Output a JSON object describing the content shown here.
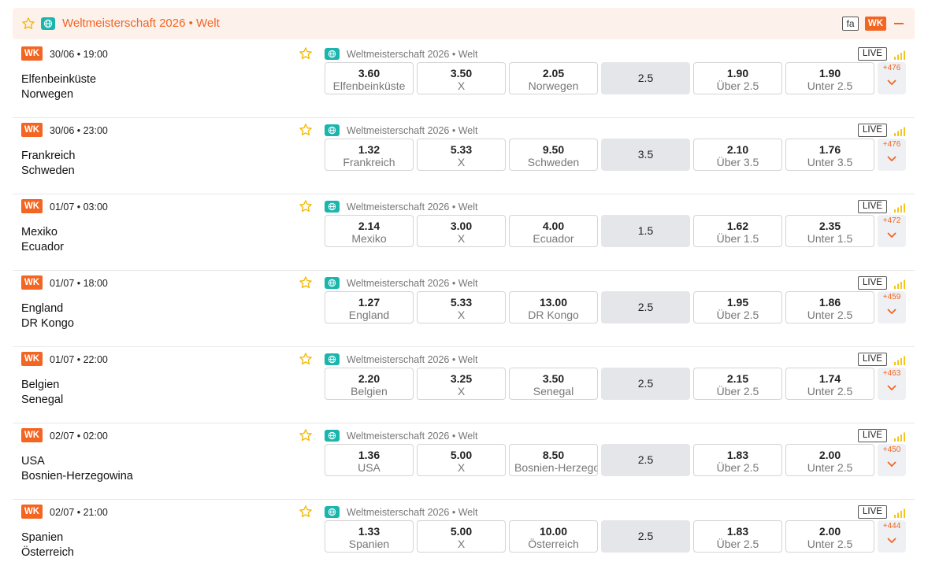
{
  "league": {
    "title": "Weltmeisterschaft 2026 • Welt",
    "badge": "WK",
    "fa_label": "fa",
    "accent": "#f26522",
    "globe_color": "#1ab5ad",
    "favorite_icon": "star-outline-icon",
    "collapse_icon": "minus-icon"
  },
  "matches": [
    {
      "badge": "WK",
      "time": "30/06 • 19:00",
      "team1": "Elfenbeinküste",
      "team2": "Norwegen",
      "league": "Weltmeisterschaft 2026 • Welt",
      "live": "LIVE",
      "odds": [
        {
          "value": "3.60",
          "label": "Elfenbeinküste"
        },
        {
          "value": "3.50",
          "label": "X"
        },
        {
          "value": "2.05",
          "label": "Norwegen"
        }
      ],
      "line": "2.5",
      "ou": [
        {
          "value": "1.90",
          "label": "Über 2.5"
        },
        {
          "value": "1.90",
          "label": "Unter 2.5"
        }
      ],
      "more": "+476"
    },
    {
      "badge": "WK",
      "time": "30/06 • 23:00",
      "team1": "Frankreich",
      "team2": "Schweden",
      "league": "Weltmeisterschaft 2026 • Welt",
      "live": "LIVE",
      "odds": [
        {
          "value": "1.32",
          "label": "Frankreich"
        },
        {
          "value": "5.33",
          "label": "X"
        },
        {
          "value": "9.50",
          "label": "Schweden"
        }
      ],
      "line": "3.5",
      "ou": [
        {
          "value": "2.10",
          "label": "Über 3.5"
        },
        {
          "value": "1.76",
          "label": "Unter 3.5"
        }
      ],
      "more": "+476"
    },
    {
      "badge": "WK",
      "time": "01/07 • 03:00",
      "team1": "Mexiko",
      "team2": "Ecuador",
      "league": "Weltmeisterschaft 2026 • Welt",
      "live": "LIVE",
      "odds": [
        {
          "value": "2.14",
          "label": "Mexiko"
        },
        {
          "value": "3.00",
          "label": "X"
        },
        {
          "value": "4.00",
          "label": "Ecuador"
        }
      ],
      "line": "1.5",
      "ou": [
        {
          "value": "1.62",
          "label": "Über 1.5"
        },
        {
          "value": "2.35",
          "label": "Unter 1.5"
        }
      ],
      "more": "+472"
    },
    {
      "badge": "WK",
      "time": "01/07 • 18:00",
      "team1": "England",
      "team2": "DR Kongo",
      "league": "Weltmeisterschaft 2026 • Welt",
      "live": "LIVE",
      "odds": [
        {
          "value": "1.27",
          "label": "England"
        },
        {
          "value": "5.33",
          "label": "X"
        },
        {
          "value": "13.00",
          "label": "DR Kongo"
        }
      ],
      "line": "2.5",
      "ou": [
        {
          "value": "1.95",
          "label": "Über 2.5"
        },
        {
          "value": "1.86",
          "label": "Unter 2.5"
        }
      ],
      "more": "+459"
    },
    {
      "badge": "WK",
      "time": "01/07 • 22:00",
      "team1": "Belgien",
      "team2": "Senegal",
      "league": "Weltmeisterschaft 2026 • Welt",
      "live": "LIVE",
      "odds": [
        {
          "value": "2.20",
          "label": "Belgien"
        },
        {
          "value": "3.25",
          "label": "X"
        },
        {
          "value": "3.50",
          "label": "Senegal"
        }
      ],
      "line": "2.5",
      "ou": [
        {
          "value": "2.15",
          "label": "Über 2.5"
        },
        {
          "value": "1.74",
          "label": "Unter 2.5"
        }
      ],
      "more": "+463"
    },
    {
      "badge": "WK",
      "time": "02/07 • 02:00",
      "team1": "USA",
      "team2": "Bosnien-Herzegowina",
      "league": "Weltmeisterschaft 2026 • Welt",
      "live": "LIVE",
      "odds": [
        {
          "value": "1.36",
          "label": "USA"
        },
        {
          "value": "5.00",
          "label": "X"
        },
        {
          "value": "8.50",
          "label": "Bosnien-Herzegowina"
        }
      ],
      "line": "2.5",
      "ou": [
        {
          "value": "1.83",
          "label": "Über 2.5"
        },
        {
          "value": "2.00",
          "label": "Unter 2.5"
        }
      ],
      "more": "+450"
    },
    {
      "badge": "WK",
      "time": "02/07 • 21:00",
      "team1": "Spanien",
      "team2": "Österreich",
      "league": "Weltmeisterschaft 2026 • Welt",
      "live": "LIVE",
      "odds": [
        {
          "value": "1.33",
          "label": "Spanien"
        },
        {
          "value": "5.00",
          "label": "X"
        },
        {
          "value": "10.00",
          "label": "Österreich"
        }
      ],
      "line": "2.5",
      "ou": [
        {
          "value": "1.83",
          "label": "Über 2.5"
        },
        {
          "value": "2.00",
          "label": "Unter 2.5"
        }
      ],
      "more": "+444"
    }
  ]
}
